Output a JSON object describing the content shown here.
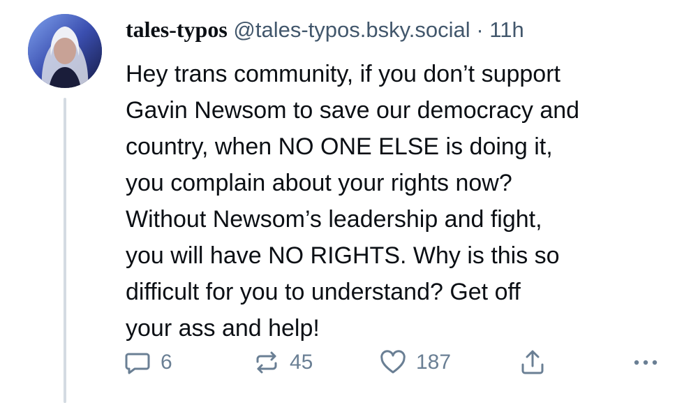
{
  "post": {
    "display_name": "tales-typos",
    "handle": "@tales-typos.bsky.social",
    "separator": "·",
    "time": "11h",
    "text": "Hey trans community, if you don’t support\nGavin Newsom to save our democracy and\ncountry, when NO ONE ELSE is doing it,\nyou complain about your rights now?\nWithout Newsom’s leadership and fight,\nyou will have NO RIGHTS. Why is this so\ndifficult for you to understand? Get off\nyour ass and help!"
  },
  "actions": {
    "reply_count": "6",
    "repost_count": "45",
    "like_count": "187"
  },
  "icons": {
    "reply": "reply-icon",
    "repost": "repost-icon",
    "like": "heart-icon",
    "share": "share-icon",
    "more": "more-icon"
  },
  "colors": {
    "text": "#0b0f14",
    "muted": "#42576c",
    "action": "#6a7f94",
    "thread_line": "#d4dbe2"
  }
}
